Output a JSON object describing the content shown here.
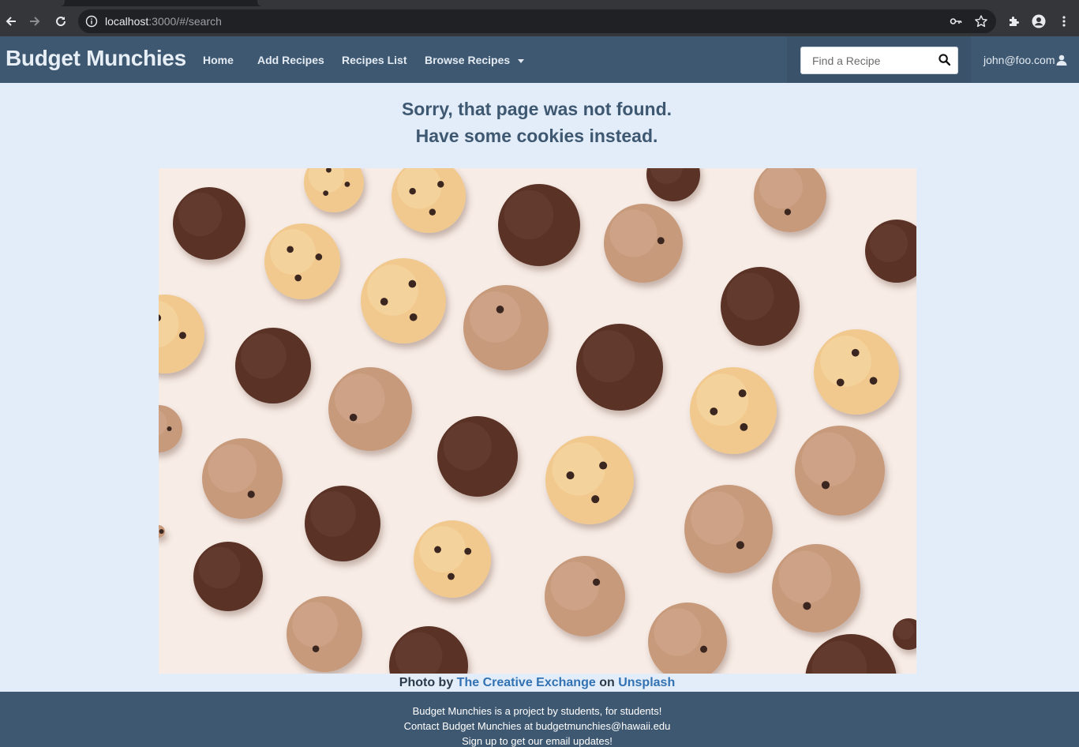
{
  "browser": {
    "url_host": "localhost",
    "url_rest": ":3000/#/search"
  },
  "navbar": {
    "brand": "Budget Munchies",
    "links": [
      "Home",
      "Add Recipes",
      "Recipes List",
      "Browse Recipes"
    ],
    "search_placeholder": "Find a Recipe",
    "user": "john@foo.com"
  },
  "main": {
    "heading_line1": "Sorry, that page was not found.",
    "heading_line2": "Have some cookies instead.",
    "credit_prefix": "Photo by",
    "credit_author": "The Creative Exchange",
    "credit_mid": "on",
    "credit_site": "Unsplash"
  },
  "footer": {
    "line1": "Budget Munchies is a project by students, for students!",
    "line2": "Contact Budget Munchies at budgetmunchies@hawaii.edu",
    "line3": "Sign up to get our email updates!"
  },
  "colors": {
    "navbar": "#3e5871",
    "page_background": "#e3edf9",
    "link": "#3272b3"
  }
}
